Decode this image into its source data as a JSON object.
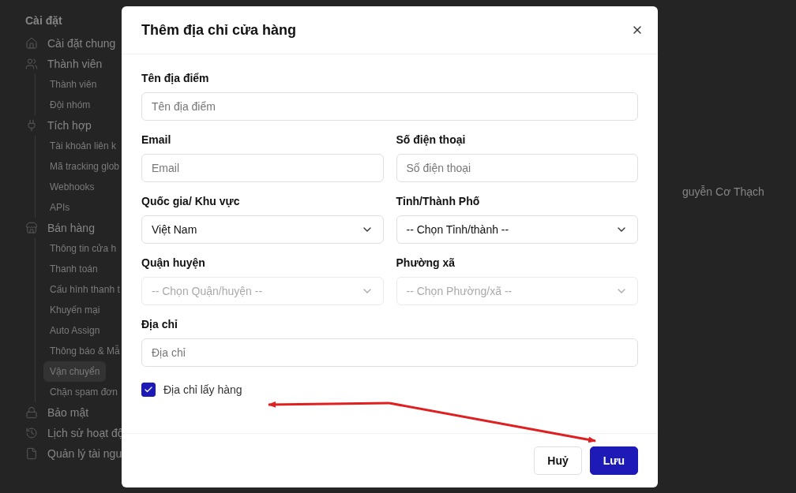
{
  "background": {
    "sidebar": {
      "title": "Cài đặt",
      "groups": [
        {
          "label": "Cài đặt chung"
        },
        {
          "label": "Thành viên",
          "children": [
            {
              "label": "Thành viên",
              "selected": false
            },
            {
              "label": "Đội nhóm",
              "selected": false
            }
          ]
        },
        {
          "label": "Tích hợp",
          "children": [
            {
              "label": "Tài khoản liên k",
              "selected": false
            },
            {
              "label": "Mã tracking glob",
              "selected": false
            },
            {
              "label": "Webhooks",
              "selected": false
            },
            {
              "label": "APIs",
              "selected": false
            }
          ]
        },
        {
          "label": "Bán hàng",
          "children": [
            {
              "label": "Thông tin cửa h",
              "selected": false
            },
            {
              "label": "Thanh toán",
              "selected": false
            },
            {
              "label": "Cấu hình thanh t",
              "selected": false
            },
            {
              "label": "Khuyến mại",
              "selected": false
            },
            {
              "label": "Auto Assign",
              "selected": false
            },
            {
              "label": "Thông báo & Mẫ",
              "selected": false
            },
            {
              "label": "Vận chuyển",
              "selected": true
            },
            {
              "label": "Chặn spam đơn",
              "selected": false
            }
          ]
        },
        {
          "label": "Bảo mật"
        },
        {
          "label": "Lịch sử hoạt độ"
        },
        {
          "label": "Quản lý tài ngu"
        }
      ]
    },
    "main_text": "guyễn Cơ Thạch"
  },
  "modal": {
    "title": "Thêm địa chỉ cửa hàng",
    "rows": [
      [
        {
          "label": "Tên địa điểm",
          "kind": "input",
          "placeholder": "Tên địa điểm"
        }
      ],
      [
        {
          "label": "Email",
          "kind": "input",
          "placeholder": "Email"
        },
        {
          "label": "Số điện thoại",
          "kind": "input",
          "placeholder": "Số điện thoại"
        }
      ],
      [
        {
          "label": "Quốc gia/ Khu vực",
          "kind": "select",
          "value": "Việt Nam",
          "disabled": false
        },
        {
          "label": "Tỉnh/Thành Phố",
          "kind": "select",
          "value": "-- Chọn Tỉnh/thành --",
          "disabled": false
        }
      ],
      [
        {
          "label": "Quận huyện",
          "kind": "select",
          "value": "-- Chọn Quận/huyện --",
          "disabled": true
        },
        {
          "label": "Phường xã",
          "kind": "select",
          "value": "-- Chọn Phường/xã --",
          "disabled": true
        }
      ],
      [
        {
          "label": "Địa chỉ",
          "kind": "input",
          "placeholder": "Địa chỉ"
        }
      ]
    ],
    "checkbox": {
      "label": "Địa chỉ lấy hàng",
      "checked": true
    },
    "buttons": [
      {
        "label": "Huỷ",
        "kind": "secondary"
      },
      {
        "label": "Lưu",
        "kind": "primary"
      }
    ]
  }
}
